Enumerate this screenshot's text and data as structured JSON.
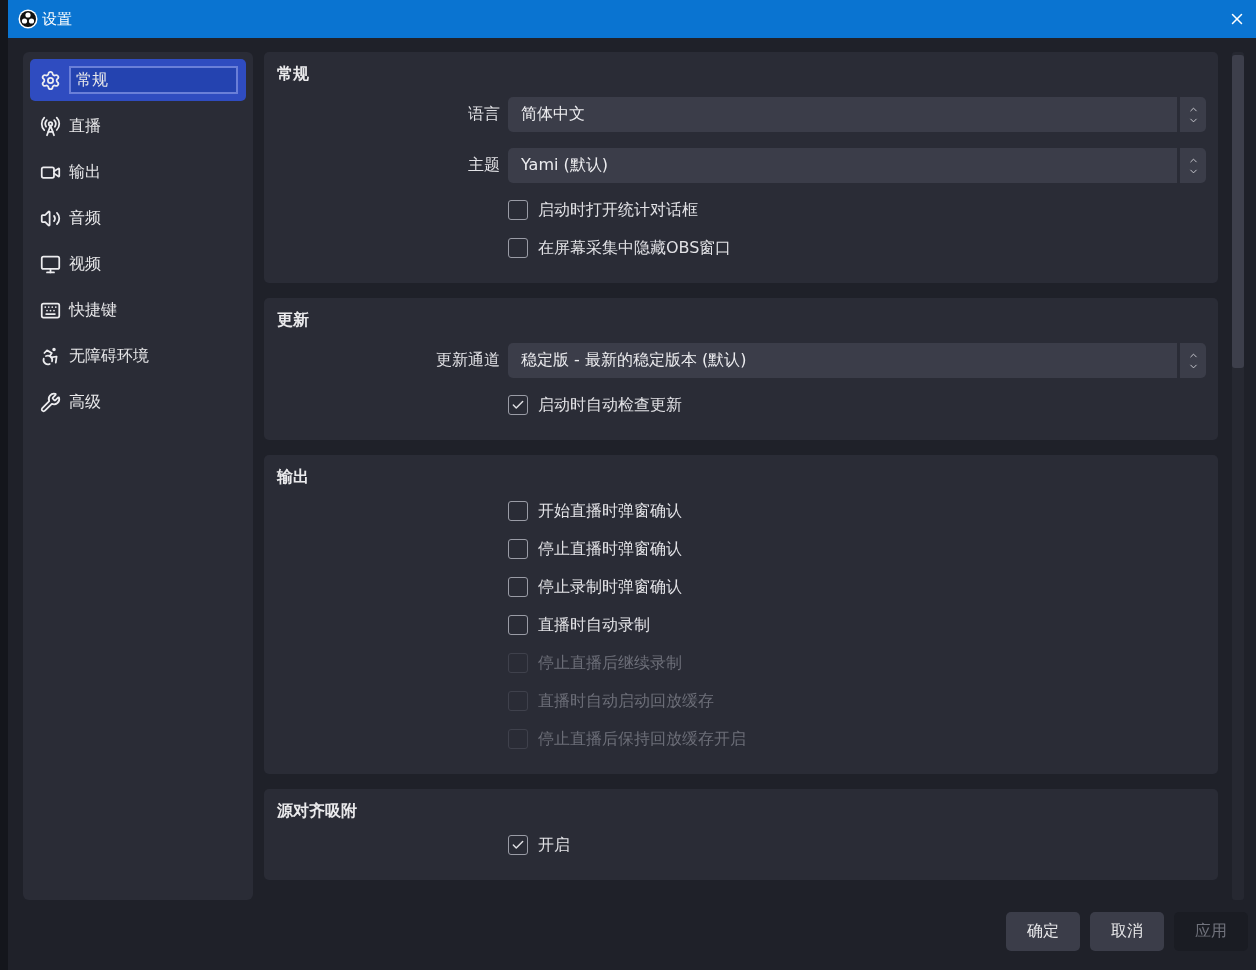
{
  "window": {
    "title": "设置"
  },
  "sidebar": {
    "items": [
      {
        "label": "常规",
        "selected": true
      },
      {
        "label": "直播",
        "selected": false
      },
      {
        "label": "输出",
        "selected": false
      },
      {
        "label": "音频",
        "selected": false
      },
      {
        "label": "视频",
        "selected": false
      },
      {
        "label": "快捷键",
        "selected": false
      },
      {
        "label": "无障碍环境",
        "selected": false
      },
      {
        "label": "高级",
        "selected": false
      }
    ]
  },
  "sections": [
    {
      "title": "常规",
      "rows": [
        {
          "kind": "select",
          "label": "语言",
          "value": "简体中文"
        },
        {
          "kind": "select",
          "label": "主题",
          "value": "Yami (默认)"
        },
        {
          "kind": "checkbox",
          "label": "启动时打开统计对话框",
          "checked": false,
          "disabled": false
        },
        {
          "kind": "checkbox",
          "label": "在屏幕采集中隐藏OBS窗口",
          "checked": false,
          "disabled": false
        }
      ]
    },
    {
      "title": "更新",
      "rows": [
        {
          "kind": "select",
          "label": "更新通道",
          "value": "稳定版 - 最新的稳定版本 (默认)"
        },
        {
          "kind": "checkbox",
          "label": "启动时自动检查更新",
          "checked": true,
          "disabled": false
        }
      ]
    },
    {
      "title": "输出",
      "rows": [
        {
          "kind": "checkbox",
          "label": "开始直播时弹窗确认",
          "checked": false,
          "disabled": false
        },
        {
          "kind": "checkbox",
          "label": "停止直播时弹窗确认",
          "checked": false,
          "disabled": false
        },
        {
          "kind": "checkbox",
          "label": "停止录制时弹窗确认",
          "checked": false,
          "disabled": false
        },
        {
          "kind": "checkbox",
          "label": "直播时自动录制",
          "checked": false,
          "disabled": false
        },
        {
          "kind": "checkbox",
          "label": "停止直播后继续录制",
          "checked": false,
          "disabled": true
        },
        {
          "kind": "checkbox",
          "label": "直播时自动启动回放缓存",
          "checked": false,
          "disabled": true
        },
        {
          "kind": "checkbox",
          "label": "停止直播后保持回放缓存开启",
          "checked": false,
          "disabled": true
        }
      ]
    },
    {
      "title": "源对齐吸附",
      "rows": [
        {
          "kind": "checkbox",
          "label": "开启",
          "checked": true,
          "disabled": false
        }
      ]
    }
  ],
  "buttons": [
    {
      "label": "确定",
      "disabled": false
    },
    {
      "label": "取消",
      "disabled": false
    },
    {
      "label": "应用",
      "disabled": true
    }
  ]
}
